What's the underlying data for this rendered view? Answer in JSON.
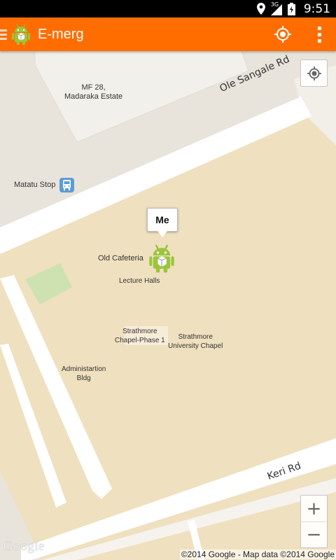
{
  "status_bar": {
    "time": "9:51",
    "network_type": "3G",
    "icons": [
      "location-icon",
      "signal-icon",
      "battery-icon"
    ]
  },
  "action_bar": {
    "title": "E-merg",
    "background": "#ff6d00",
    "icons": [
      "menu-icon",
      "android-app-icon",
      "locate-icon",
      "overflow-menu-icon"
    ]
  },
  "map": {
    "places": {
      "mf28": "MF 28,\nMadaraka Estate",
      "matatu_stop": "Matatu Stop",
      "old_cafeteria": "Old Cafeteria",
      "lecture_halls": "Lecture Halls",
      "chapel_phase": "Strathmore\nChapel-Phase 1",
      "university_chapel": "Strathmore\nUniversity Chapel",
      "admin_bldg": "Administartion\nBldg"
    },
    "roads": {
      "ole_sangale": "Ole Sangale Rd",
      "keri": "Keri Rd"
    },
    "marker": {
      "label": "Me",
      "icon": "android-marker-icon"
    },
    "zoom": {
      "in_label": "+",
      "out_label": "−"
    },
    "logo": "Google",
    "attribution": "©2014 Google - Map data ©2014 Google",
    "colors": {
      "campus": "#efe0bf",
      "road": "#ffffff",
      "background": "#e8e4dc",
      "park": "#cde2b0"
    }
  }
}
